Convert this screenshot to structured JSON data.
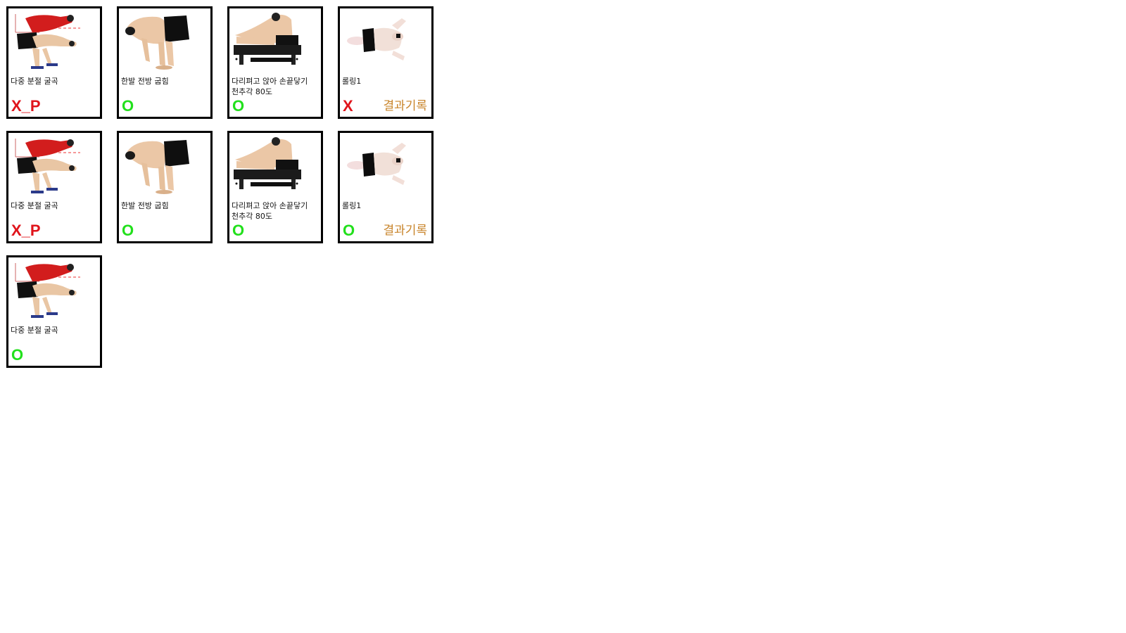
{
  "colors": {
    "result_fail": "#e0141b",
    "result_pass": "#22e01c",
    "record_link": "#c8842a",
    "card_border": "#000000"
  },
  "cards": [
    {
      "image": "multi-segment-flexion-photo",
      "label": "다중 분절 굴곡",
      "result": "X_P",
      "status": "fail"
    },
    {
      "image": "single-leg-forward-bend-photo",
      "label": "한발 전방 굽힘",
      "result": "O",
      "status": "pass"
    },
    {
      "image": "seated-toe-touch-photo",
      "label": "다리펴고 앉아 손끝닿기\n천추각 80도",
      "result": "O",
      "status": "pass"
    },
    {
      "image": "rolling-photo",
      "label": "롤링1",
      "result": "X",
      "status": "fail",
      "record_label": "결과기록"
    },
    {
      "image": "multi-segment-flexion-photo",
      "label": "다중 분절 굴곡",
      "result": "X_P",
      "status": "fail"
    },
    {
      "image": "single-leg-forward-bend-photo",
      "label": "한발 전방 굽힘",
      "result": "O",
      "status": "pass"
    },
    {
      "image": "seated-toe-touch-photo",
      "label": "다리펴고 앉아 손끝닿기\n천추각 80도",
      "result": "O",
      "status": "pass"
    },
    {
      "image": "rolling-photo",
      "label": "롤링1",
      "result": "O",
      "status": "pass",
      "record_label": "결과기록"
    },
    {
      "image": "multi-segment-flexion-photo",
      "label": "다중 분절 굴곡",
      "result": "O",
      "status": "pass"
    }
  ]
}
